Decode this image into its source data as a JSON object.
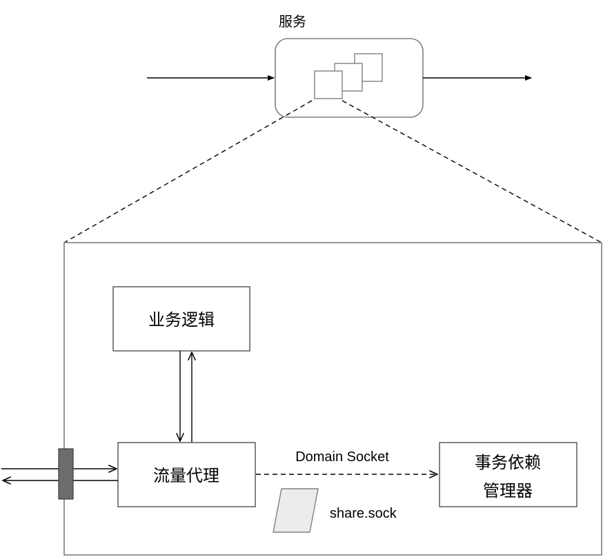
{
  "service": {
    "title": "服务"
  },
  "nodes": {
    "business_logic": "业务逻辑",
    "traffic_proxy": "流量代理",
    "dependency_manager_line1": "事务依赖",
    "dependency_manager_line2": "管理器"
  },
  "edges": {
    "domain_socket": "Domain Socket"
  },
  "socket_file": "share.sock",
  "colors": {
    "stroke": "#000000",
    "box_border": "#5a5a5a",
    "service_border": "#7f7f7f",
    "port_fill": "#6d6d6d",
    "file_fill": "#ececec"
  }
}
